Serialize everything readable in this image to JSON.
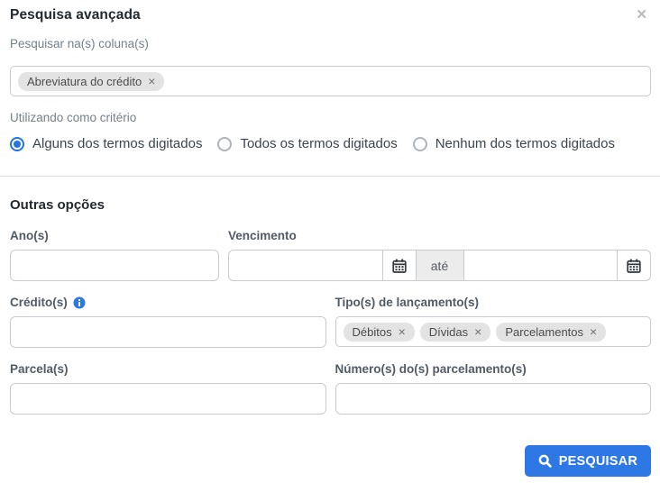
{
  "modal": {
    "title": "Pesquisa avançada"
  },
  "icons": {
    "close": "✕",
    "tag_remove": "×"
  },
  "search_columns": {
    "label": "Pesquisar na(s) coluna(s)",
    "tags": [
      {
        "label": "Abreviatura do crédito"
      }
    ]
  },
  "criteria": {
    "label": "Utilizando como critério",
    "options": [
      {
        "label": "Alguns dos termos digitados",
        "selected": true
      },
      {
        "label": "Todos os termos digitados",
        "selected": false
      },
      {
        "label": "Nenhum dos termos digitados",
        "selected": false
      }
    ]
  },
  "other_options": {
    "heading": "Outras opções",
    "anos": {
      "label": "Ano(s)",
      "value": ""
    },
    "vencimento": {
      "label": "Vencimento",
      "from_value": "",
      "separator": "até",
      "to_value": ""
    },
    "creditos": {
      "label": "Crédito(s)",
      "value": ""
    },
    "tipos": {
      "label": "Tipo(s) de lançamento(s)",
      "tags": [
        {
          "label": "Débitos"
        },
        {
          "label": "Dívidas"
        },
        {
          "label": "Parcelamentos"
        }
      ]
    },
    "parcelas": {
      "label": "Parcela(s)",
      "value": ""
    },
    "numeros": {
      "label": "Número(s) do(s) parcelamento(s)",
      "value": ""
    }
  },
  "footer": {
    "search_button_label": "PESQUISAR"
  },
  "colors": {
    "primary": "#2d78e4",
    "radio_selected": "#2374e1",
    "tag_bg": "#e3e3e3",
    "input_border": "#cbcbcb",
    "divider": "#dddddd",
    "muted_text": "#75808d"
  }
}
